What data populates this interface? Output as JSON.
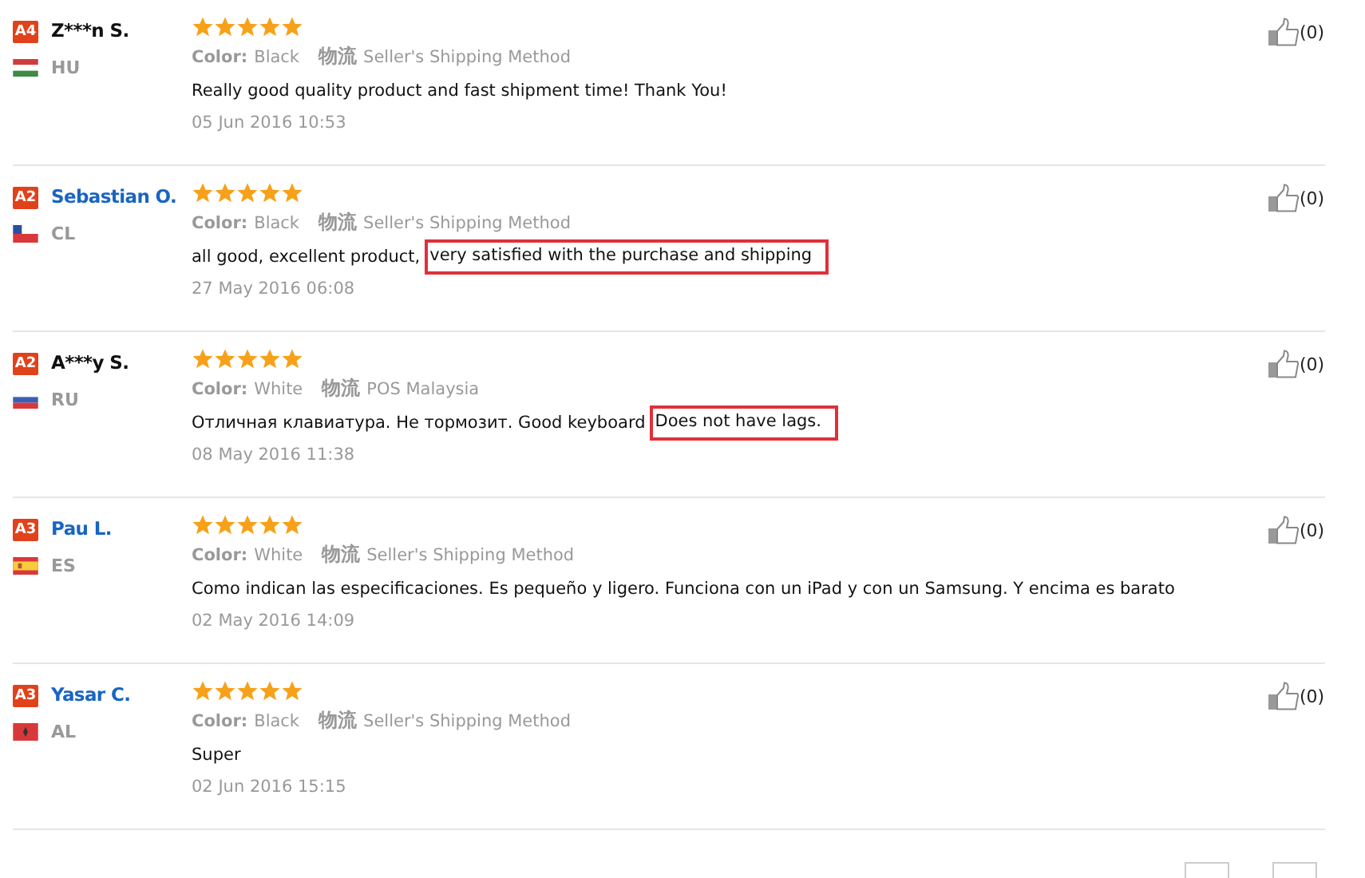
{
  "reviews": [
    {
      "badge": "A4",
      "name": "Z***n S.",
      "linked": false,
      "kind": "hu",
      "country": "HU",
      "stars": 5,
      "color_label": "Color:",
      "color_value": "Black",
      "logistics_label": "物流",
      "logistics_value": "Seller's Shipping Method",
      "text": [
        {
          "text": "Really good quality product and fast shipment time! Thank You!",
          "highlighted": false
        }
      ],
      "date": "05 Jun 2016 10:53",
      "likes": "(0)"
    },
    {
      "badge": "A2",
      "name": "Sebastian O.",
      "linked": true,
      "kind": "cl",
      "country": "CL",
      "stars": 5,
      "color_label": "Color:",
      "color_value": "Black",
      "logistics_label": "物流",
      "logistics_value": "Seller's Shipping Method",
      "text": [
        {
          "text": "all good, excellent product,",
          "highlighted": false
        },
        {
          "text": "very satisfied with the purchase and shipping",
          "highlighted": true
        }
      ],
      "date": "27 May 2016 06:08",
      "likes": "(0)"
    },
    {
      "badge": "A2",
      "name": "A***y S.",
      "linked": false,
      "kind": "ru",
      "country": "RU",
      "stars": 5,
      "color_label": "Color:",
      "color_value": "White",
      "logistics_label": "物流",
      "logistics_value": "POS Malaysia",
      "text": [
        {
          "text": "Отличная клавиатура. Не тормозит. Good keyboard",
          "highlighted": false
        },
        {
          "text": "Does not have lags.",
          "highlighted": true
        }
      ],
      "date": "08 May 2016 11:38",
      "likes": "(0)"
    },
    {
      "badge": "A3",
      "name": "Pau L.",
      "linked": true,
      "kind": "es",
      "country": "ES",
      "stars": 5,
      "color_label": "Color:",
      "color_value": "White",
      "logistics_label": "物流",
      "logistics_value": "Seller's Shipping Method",
      "text": [
        {
          "text": "Como indican las especificaciones. Es pequeño y ligero. Funciona con un iPad y con un Samsung. Y encima es barato",
          "highlighted": false
        }
      ],
      "date": "02 May 2016 14:09",
      "likes": "(0)"
    },
    {
      "badge": "A3",
      "name": "Yasar C.",
      "linked": true,
      "kind": "al",
      "country": "AL",
      "stars": 5,
      "color_label": "Color:",
      "color_value": "Black",
      "logistics_label": "物流",
      "logistics_value": "Seller's Shipping Method",
      "text": [
        {
          "text": "Super",
          "highlighted": false
        }
      ],
      "date": "02 Jun 2016 15:15",
      "likes": "(0)"
    }
  ]
}
